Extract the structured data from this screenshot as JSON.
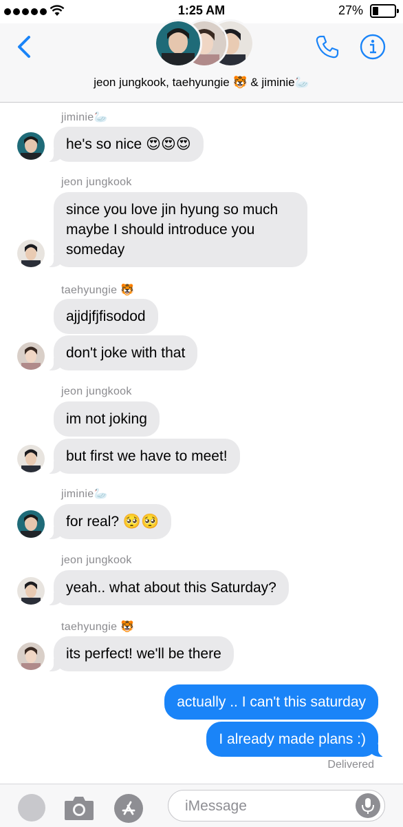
{
  "status": {
    "time": "1:25 AM",
    "battery": "27%"
  },
  "header": {
    "title": "jeon jungkook, taehyungie 🐯 & jiminie🦢"
  },
  "messages": [
    {
      "sender": "jiminie🦢",
      "text": "he's so nice 😍😍😍"
    },
    {
      "sender": "jeon jungkook",
      "text_lines": [
        "since you love jin hyung so much",
        "maybe I should introduce you",
        "someday"
      ]
    },
    {
      "sender": "taehyungie 🐯",
      "text": "ajjdjfjfisodod"
    },
    {
      "text": "don't joke with that"
    },
    {
      "sender": "jeon jungkook",
      "text": "im not joking"
    },
    {
      "text": "but first we have to meet!"
    },
    {
      "sender": "jiminie🦢",
      "text": "for real? 🥺🥺"
    },
    {
      "sender": "jeon jungkook",
      "text": "yeah.. what about this Saturday?"
    },
    {
      "sender": "taehyungie 🐯",
      "text": "its perfect! we'll be there"
    },
    {
      "text": "actually .. I can't this saturday"
    },
    {
      "text": "I already made plans :)"
    }
  ],
  "delivered": "Delivered",
  "input": {
    "placeholder": "iMessage"
  }
}
